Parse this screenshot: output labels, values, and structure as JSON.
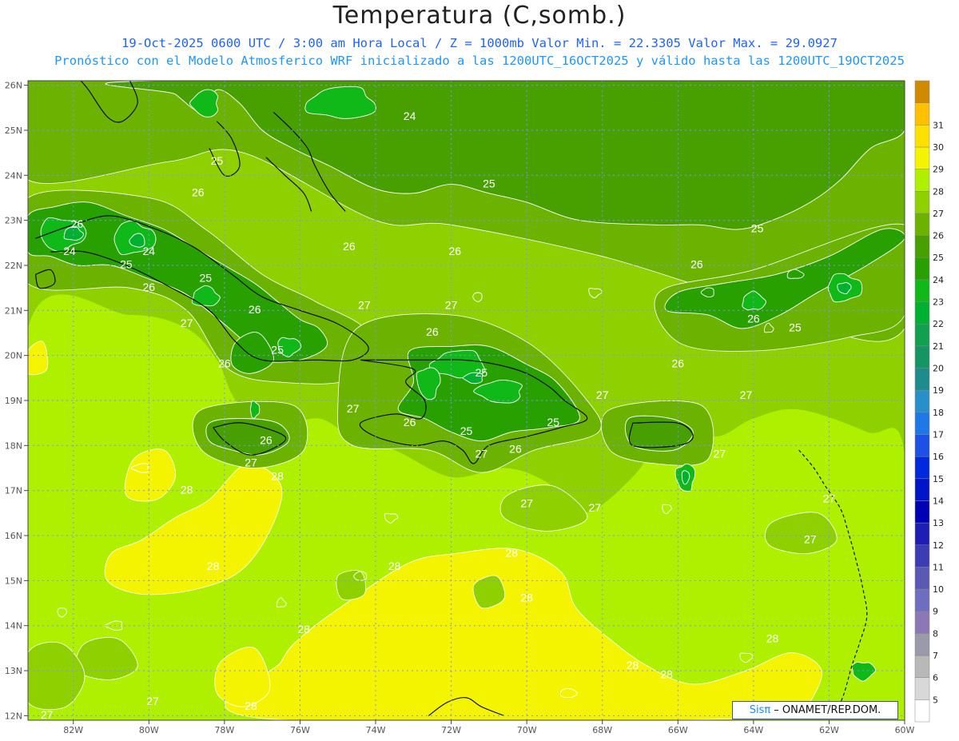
{
  "header": {
    "title": "Temperatura (C,somb.)",
    "line1": "19-Oct-2025  0600 UTC / 3:00 am Hora Local / Z = 1000mb   Valor Min. = 22.3305  Valor Max. = 29.0927",
    "line2": "Pronóstico con el Modelo Atmosferico WRF inicializado a las 1200UTC_16OCT2025 y válido hasta las  1200UTC_19OCT2025"
  },
  "credit": {
    "brand": "Sisπ",
    "text": " – ONAMET/REP.DOM."
  },
  "colors": {
    "bin_22": "#00b030",
    "bin_23": "#10b818",
    "bin_24": "#28a000",
    "bin_25": "#48a000",
    "bin_26": "#6bb300",
    "bin_27": "#8fd000",
    "bin_28": "#aef000",
    "bin_29": "#f4f400",
    "contour": "#ffffff",
    "coast": "#000000",
    "grid": "#8c8cff"
  },
  "chart_data": {
    "type": "heatmap",
    "title": "Temperatura (C,somb.)",
    "units": "C",
    "level": "1000mb",
    "value_min": 22.3305,
    "value_max": 29.0927,
    "xlim": [
      -83.2,
      -60.0
    ],
    "ylim": [
      11.9,
      26.1
    ],
    "x_ticks": [
      "82W",
      "80W",
      "78W",
      "76W",
      "74W",
      "72W",
      "70W",
      "68W",
      "66W",
      "64W",
      "62W",
      "60W"
    ],
    "y_ticks": [
      "12N",
      "13N",
      "14N",
      "15N",
      "16N",
      "17N",
      "18N",
      "19N",
      "20N",
      "21N",
      "22N",
      "23N",
      "24N",
      "25N",
      "26N"
    ],
    "colorbar": {
      "levels": [
        5,
        6,
        7,
        8,
        9,
        10,
        11,
        12,
        13,
        14,
        15,
        16,
        17,
        18,
        19,
        20,
        21,
        22,
        23,
        24,
        25,
        26,
        27,
        28,
        29,
        30,
        31
      ],
      "colors": [
        "#ffffff",
        "#d8d8d8",
        "#b8b8b8",
        "#9a9aaa",
        "#8c78b4",
        "#6e6ebe",
        "#5a5ab4",
        "#3c3cb4",
        "#1e1eb4",
        "#0000b4",
        "#0014c8",
        "#0028dc",
        "#1e50e6",
        "#1e78e6",
        "#2890c8",
        "#1e8c8c",
        "#149664",
        "#10a050",
        "#00b030",
        "#10b818",
        "#28a000",
        "#48a000",
        "#6bb300",
        "#8fd000",
        "#aef000",
        "#f4f400",
        "#ffe000",
        "#ffc000",
        "#d08a00"
      ]
    },
    "contour_labels": [
      {
        "text": "24",
        "lon": -73.1,
        "lat": 25.3
      },
      {
        "text": "25",
        "lon": -78.2,
        "lat": 24.3
      },
      {
        "text": "26",
        "lon": -78.7,
        "lat": 23.6
      },
      {
        "text": "25",
        "lon": -71.0,
        "lat": 23.8
      },
      {
        "text": "25",
        "lon": -63.9,
        "lat": 22.8
      },
      {
        "text": "26",
        "lon": -81.9,
        "lat": 22.9
      },
      {
        "text": "24",
        "lon": -82.1,
        "lat": 22.3
      },
      {
        "text": "24",
        "lon": -80.0,
        "lat": 22.3
      },
      {
        "text": "25",
        "lon": -80.6,
        "lat": 22.0
      },
      {
        "text": "25",
        "lon": -78.5,
        "lat": 21.7
      },
      {
        "text": "26",
        "lon": -80.0,
        "lat": 21.5
      },
      {
        "text": "26",
        "lon": -74.7,
        "lat": 22.4
      },
      {
        "text": "26",
        "lon": -71.9,
        "lat": 22.3
      },
      {
        "text": "26",
        "lon": -65.5,
        "lat": 22.0
      },
      {
        "text": "27",
        "lon": -74.3,
        "lat": 21.1
      },
      {
        "text": "27",
        "lon": -72.0,
        "lat": 21.1
      },
      {
        "text": "26",
        "lon": -77.2,
        "lat": 21.0
      },
      {
        "text": "27",
        "lon": -79.0,
        "lat": 20.7
      },
      {
        "text": "26",
        "lon": -64.0,
        "lat": 20.8
      },
      {
        "text": "25",
        "lon": -62.9,
        "lat": 20.6
      },
      {
        "text": "25",
        "lon": -76.6,
        "lat": 20.1
      },
      {
        "text": "26",
        "lon": -72.5,
        "lat": 20.5
      },
      {
        "text": "26",
        "lon": -78.0,
        "lat": 19.8
      },
      {
        "text": "25",
        "lon": -71.2,
        "lat": 19.6
      },
      {
        "text": "26",
        "lon": -66.0,
        "lat": 19.8
      },
      {
        "text": "27",
        "lon": -74.6,
        "lat": 18.8
      },
      {
        "text": "27",
        "lon": -68.0,
        "lat": 19.1
      },
      {
        "text": "27",
        "lon": -64.2,
        "lat": 19.1
      },
      {
        "text": "26",
        "lon": -73.1,
        "lat": 18.5
      },
      {
        "text": "25",
        "lon": -71.6,
        "lat": 18.3
      },
      {
        "text": "25",
        "lon": -69.3,
        "lat": 18.5
      },
      {
        "text": "26",
        "lon": -76.9,
        "lat": 18.1
      },
      {
        "text": "26",
        "lon": -70.3,
        "lat": 17.9
      },
      {
        "text": "27",
        "lon": -71.2,
        "lat": 17.8
      },
      {
        "text": "27",
        "lon": -77.3,
        "lat": 17.6
      },
      {
        "text": "28",
        "lon": -76.6,
        "lat": 17.3
      },
      {
        "text": "27",
        "lon": -64.9,
        "lat": 17.8
      },
      {
        "text": "28",
        "lon": -79.0,
        "lat": 17.0
      },
      {
        "text": "27",
        "lon": -70.0,
        "lat": 16.7
      },
      {
        "text": "27",
        "lon": -68.2,
        "lat": 16.6
      },
      {
        "text": "27",
        "lon": -62.0,
        "lat": 16.8
      },
      {
        "text": "27",
        "lon": -62.5,
        "lat": 15.9
      },
      {
        "text": "28",
        "lon": -70.4,
        "lat": 15.6
      },
      {
        "text": "28",
        "lon": -78.3,
        "lat": 15.3
      },
      {
        "text": "28",
        "lon": -73.5,
        "lat": 15.3
      },
      {
        "text": "28",
        "lon": -70.0,
        "lat": 14.6
      },
      {
        "text": "28",
        "lon": -75.9,
        "lat": 13.9
      },
      {
        "text": "28",
        "lon": -63.5,
        "lat": 13.7
      },
      {
        "text": "28",
        "lon": -67.2,
        "lat": 13.1
      },
      {
        "text": "28",
        "lon": -66.3,
        "lat": 12.9
      },
      {
        "text": "27",
        "lon": -79.9,
        "lat": 12.3
      },
      {
        "text": "28",
        "lon": -77.3,
        "lat": 12.2
      },
      {
        "text": "27",
        "lon": -82.7,
        "lat": 12.0
      }
    ],
    "regions": [
      {
        "name": "dark-north-mid",
        "value": 25,
        "poly": [
          [
            -79.8,
            26.1
          ],
          [
            -60.0,
            26.1
          ],
          [
            -60.0,
            25.0
          ],
          [
            -60.9,
            24.6
          ],
          [
            -61.7,
            23.9
          ],
          [
            -62.5,
            23.4
          ],
          [
            -63.5,
            23.0
          ],
          [
            -64.4,
            22.8
          ],
          [
            -65.4,
            22.9
          ],
          [
            -66.6,
            22.9
          ],
          [
            -68.6,
            23.0
          ],
          [
            -70.0,
            23.4
          ],
          [
            -71.0,
            23.6
          ],
          [
            -72.0,
            23.8
          ],
          [
            -73.0,
            23.6
          ],
          [
            -74.0,
            23.7
          ],
          [
            -75.2,
            24.2
          ],
          [
            -76.2,
            24.6
          ],
          [
            -77.0,
            25.0
          ],
          [
            -77.6,
            25.6
          ],
          [
            -78.2,
            25.9
          ],
          [
            -78.6,
            25.4
          ],
          [
            -79.3,
            25.8
          ]
        ]
      },
      {
        "name": "cuba-w",
        "value": 24,
        "poly": [
          [
            -83.2,
            23.1
          ],
          [
            -82.5,
            23.3
          ],
          [
            -81.6,
            23.4
          ],
          [
            -80.6,
            23.1
          ],
          [
            -79.6,
            22.8
          ],
          [
            -78.8,
            22.4
          ],
          [
            -78.0,
            22.0
          ],
          [
            -77.2,
            21.6
          ],
          [
            -76.6,
            21.2
          ],
          [
            -76.0,
            20.8
          ],
          [
            -75.5,
            20.6
          ],
          [
            -75.3,
            20.2
          ],
          [
            -76.0,
            19.9
          ],
          [
            -77.0,
            19.9
          ],
          [
            -77.6,
            20.4
          ],
          [
            -78.3,
            20.9
          ],
          [
            -79.1,
            21.4
          ],
          [
            -80.0,
            21.7
          ],
          [
            -81.0,
            22.0
          ],
          [
            -81.9,
            22.0
          ],
          [
            -82.6,
            22.2
          ],
          [
            -83.2,
            22.3
          ]
        ]
      },
      {
        "name": "cuba-se",
        "value": 24,
        "poly": [
          [
            -77.7,
            20.3
          ],
          [
            -77.1,
            20.5
          ],
          [
            -76.7,
            19.9
          ],
          [
            -77.3,
            19.6
          ],
          [
            -77.8,
            19.8
          ]
        ]
      },
      {
        "name": "hispaniola",
        "value": 24,
        "poly": [
          [
            -73.1,
            20.1
          ],
          [
            -72.0,
            20.2
          ],
          [
            -71.0,
            20.2
          ],
          [
            -70.0,
            19.8
          ],
          [
            -69.2,
            19.4
          ],
          [
            -68.6,
            18.6
          ],
          [
            -69.4,
            18.4
          ],
          [
            -70.4,
            18.3
          ],
          [
            -71.2,
            18.1
          ],
          [
            -72.0,
            18.3
          ],
          [
            -72.7,
            18.6
          ],
          [
            -73.4,
            18.8
          ],
          [
            -73.0,
            19.4
          ]
        ]
      },
      {
        "name": "jamaica",
        "value": 25,
        "poly": [
          [
            -78.4,
            18.5
          ],
          [
            -77.6,
            18.6
          ],
          [
            -76.6,
            18.5
          ],
          [
            -76.3,
            18.1
          ],
          [
            -77.0,
            17.8
          ],
          [
            -77.8,
            17.9
          ],
          [
            -78.4,
            18.1
          ]
        ]
      },
      {
        "name": "puerto-rico",
        "value": 25,
        "poly": [
          [
            -67.3,
            18.6
          ],
          [
            -66.2,
            18.6
          ],
          [
            -65.6,
            18.3
          ],
          [
            -66.1,
            17.9
          ],
          [
            -67.2,
            18.0
          ]
        ]
      },
      {
        "name": "ne-islands",
        "value": 24,
        "poly": [
          [
            -60.0,
            22.6
          ],
          [
            -61.0,
            22.0
          ],
          [
            -62.3,
            21.4
          ],
          [
            -63.3,
            20.9
          ],
          [
            -64.3,
            20.6
          ],
          [
            -65.2,
            20.9
          ],
          [
            -66.3,
            21.0
          ],
          [
            -66.0,
            21.4
          ],
          [
            -64.8,
            21.6
          ],
          [
            -63.4,
            21.8
          ],
          [
            -62.0,
            22.2
          ],
          [
            -60.6,
            22.8
          ]
        ]
      }
    ],
    "coastlines": [
      {
        "name": "cuba",
        "pts": [
          [
            -83.0,
            22.6
          ],
          [
            -82.0,
            22.9
          ],
          [
            -81.0,
            23.1
          ],
          [
            -79.8,
            22.8
          ],
          [
            -78.8,
            22.4
          ],
          [
            -77.8,
            21.8
          ],
          [
            -77.0,
            21.3
          ],
          [
            -76.0,
            21.0
          ],
          [
            -75.0,
            20.7
          ],
          [
            -74.2,
            20.2
          ],
          [
            -74.6,
            19.9
          ],
          [
            -75.6,
            19.9
          ],
          [
            -77.0,
            19.9
          ],
          [
            -77.7,
            20.3
          ],
          [
            -78.4,
            21.0
          ],
          [
            -79.4,
            21.5
          ],
          [
            -80.6,
            22.0
          ],
          [
            -81.7,
            22.3
          ],
          [
            -82.6,
            22.3
          ]
        ]
      },
      {
        "name": "isla-juventud",
        "pts": [
          [
            -83.0,
            21.8
          ],
          [
            -82.6,
            21.9
          ],
          [
            -82.5,
            21.6
          ],
          [
            -82.9,
            21.5
          ],
          [
            -83.0,
            21.8
          ]
        ]
      },
      {
        "name": "hispaniola",
        "pts": [
          [
            -74.4,
            19.9
          ],
          [
            -73.4,
            19.9
          ],
          [
            -72.5,
            19.9
          ],
          [
            -71.7,
            19.9
          ],
          [
            -70.8,
            19.8
          ],
          [
            -70.0,
            19.6
          ],
          [
            -69.4,
            19.3
          ],
          [
            -69.0,
            19.0
          ],
          [
            -68.4,
            18.6
          ],
          [
            -69.1,
            18.4
          ],
          [
            -70.0,
            18.2
          ],
          [
            -71.0,
            18.0
          ],
          [
            -71.4,
            17.6
          ],
          [
            -71.7,
            17.9
          ],
          [
            -72.2,
            18.1
          ],
          [
            -73.0,
            18.0
          ],
          [
            -74.0,
            18.2
          ],
          [
            -74.4,
            18.5
          ],
          [
            -73.5,
            18.7
          ],
          [
            -72.8,
            18.6
          ],
          [
            -72.7,
            19.0
          ],
          [
            -73.2,
            19.4
          ],
          [
            -73.0,
            19.7
          ],
          [
            -74.4,
            19.9
          ]
        ]
      },
      {
        "name": "jamaica",
        "pts": [
          [
            -78.3,
            18.4
          ],
          [
            -77.5,
            18.5
          ],
          [
            -76.4,
            18.2
          ],
          [
            -76.8,
            17.9
          ],
          [
            -77.4,
            17.8
          ],
          [
            -78.0,
            18.1
          ],
          [
            -78.3,
            18.4
          ]
        ]
      },
      {
        "name": "puerto-rico",
        "pts": [
          [
            -67.2,
            18.5
          ],
          [
            -66.0,
            18.5
          ],
          [
            -65.6,
            18.2
          ],
          [
            -66.0,
            18.0
          ],
          [
            -67.2,
            18.0
          ],
          [
            -67.2,
            18.5
          ]
        ]
      },
      {
        "name": "florida",
        "pts": [
          [
            -80.5,
            26.1
          ],
          [
            -80.3,
            25.6
          ],
          [
            -80.7,
            25.2
          ],
          [
            -81.1,
            25.3
          ],
          [
            -81.6,
            25.9
          ],
          [
            -81.8,
            26.1
          ]
        ]
      },
      {
        "name": "andros",
        "pts": [
          [
            -78.2,
            25.2
          ],
          [
            -77.8,
            24.8
          ],
          [
            -77.6,
            24.2
          ],
          [
            -78.0,
            24.0
          ],
          [
            -78.4,
            24.6
          ]
        ]
      },
      {
        "name": "bahamas-chain",
        "pts": [
          [
            -76.7,
            25.4
          ],
          [
            -76.2,
            25.0
          ],
          [
            -75.8,
            24.6
          ],
          [
            -75.6,
            24.2
          ],
          [
            -75.2,
            23.6
          ],
          [
            -74.8,
            23.2
          ]
        ]
      },
      {
        "name": "exuma",
        "pts": [
          [
            -76.9,
            24.4
          ],
          [
            -76.4,
            24.0
          ],
          [
            -75.9,
            23.6
          ],
          [
            -75.7,
            23.2
          ]
        ]
      },
      {
        "name": "lesser-antilles",
        "pts": [
          [
            -62.8,
            17.9
          ],
          [
            -62.4,
            17.5
          ],
          [
            -62.1,
            17.1
          ],
          [
            -61.7,
            16.6
          ],
          [
            -61.5,
            16.1
          ],
          [
            -61.3,
            15.5
          ],
          [
            -61.1,
            14.8
          ],
          [
            -61.0,
            14.2
          ],
          [
            -61.2,
            13.6
          ],
          [
            -61.4,
            13.1
          ],
          [
            -61.6,
            12.5
          ],
          [
            -61.8,
            12.1
          ]
        ]
      },
      {
        "name": "barbados",
        "pts": [
          [
            -59.6,
            13.3
          ],
          [
            -59.5,
            13.0
          ],
          [
            -59.7,
            13.1
          ]
        ]
      },
      {
        "name": "south-america",
        "pts": [
          [
            -72.6,
            12.0
          ],
          [
            -72.1,
            12.3
          ],
          [
            -71.6,
            12.4
          ],
          [
            -71.2,
            12.2
          ],
          [
            -70.6,
            12.0
          ]
        ]
      }
    ]
  }
}
